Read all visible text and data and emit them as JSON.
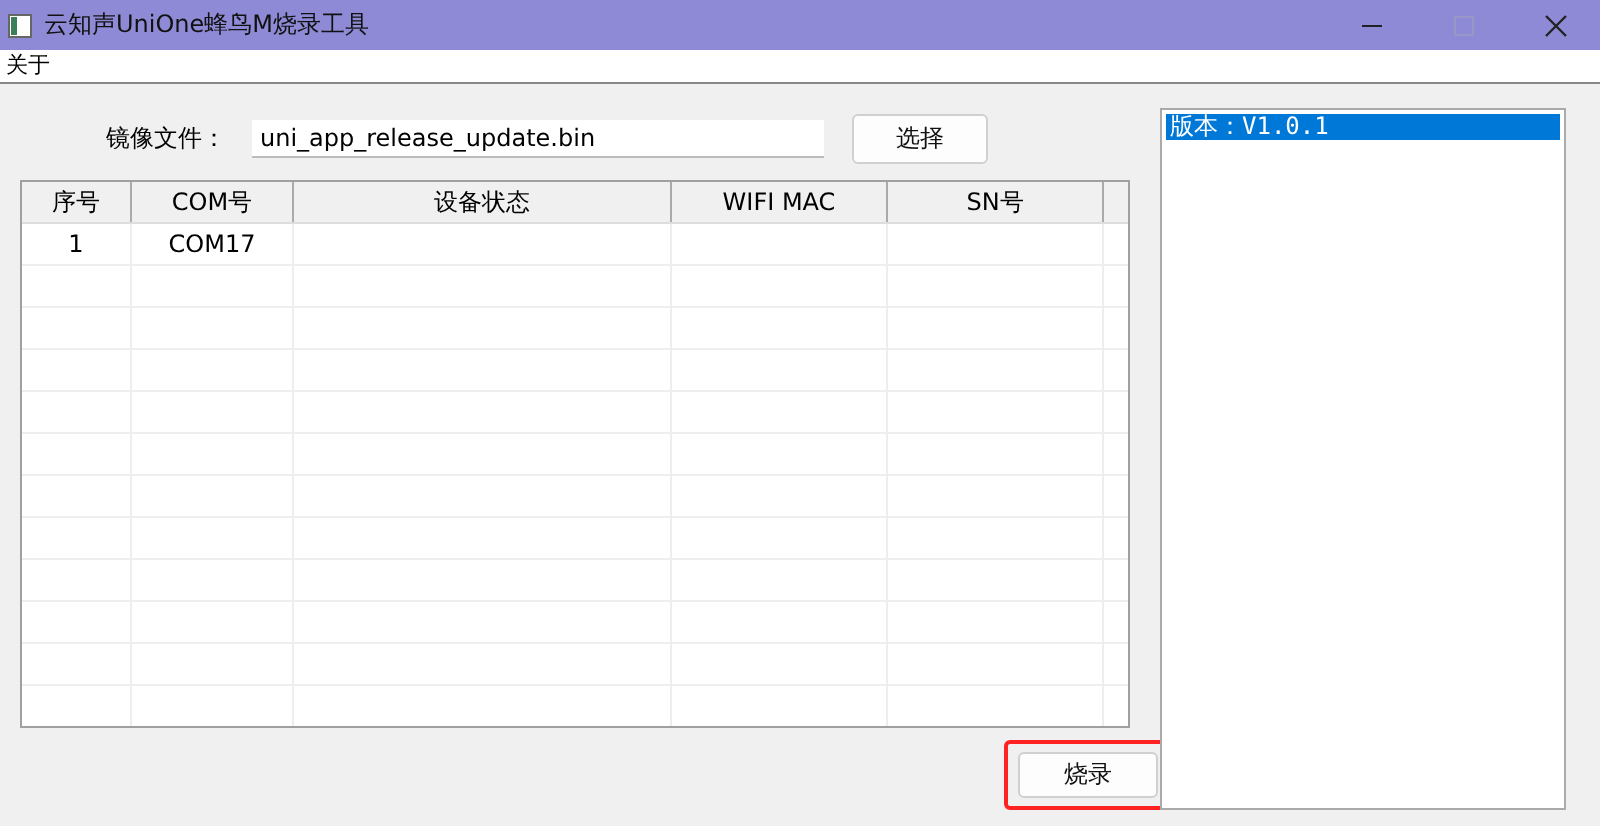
{
  "window": {
    "title": "云知声UniOne蜂鸟M烧录工具"
  },
  "menu": [
    "关于"
  ],
  "image_file": {
    "label": "镜像文件：",
    "value": "uni_app_release_update.bin",
    "button": "选择"
  },
  "table": {
    "columns": [
      "序号",
      "COM号",
      "设备状态",
      "WIFI MAC",
      "SN号"
    ],
    "rows": [
      [
        "1",
        "COM17",
        "",
        "",
        ""
      ]
    ]
  },
  "burn_button": {
    "label": "烧录",
    "highlighted": true
  },
  "log": [
    {
      "text": "版本：V1.0.1",
      "selected": true
    }
  ]
}
